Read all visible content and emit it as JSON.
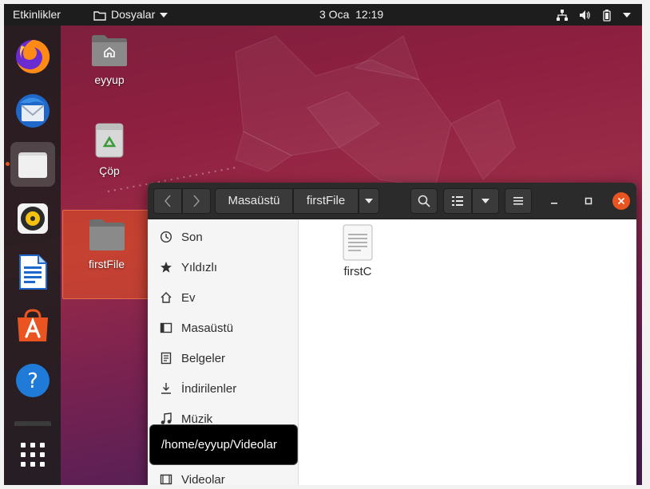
{
  "topbar": {
    "activities": "Etkinlikler",
    "app_menu": "Dosyalar",
    "clock_date": "3 Oca",
    "clock_time": "12:19"
  },
  "dock": {
    "items": [
      {
        "name": "firefox"
      },
      {
        "name": "thunderbird"
      },
      {
        "name": "files",
        "active": true
      },
      {
        "name": "rhythmbox"
      },
      {
        "name": "libreoffice-writer"
      },
      {
        "name": "ubuntu-software"
      },
      {
        "name": "help"
      },
      {
        "name": "show-applications"
      }
    ]
  },
  "desktop": {
    "home_label": "eyyup",
    "trash_label": "Çöp",
    "folder_label": "firstFile"
  },
  "window": {
    "path": [
      "Masaüstü",
      "firstFile"
    ],
    "sidebar": [
      {
        "label": "Son",
        "icon": "clock-icon"
      },
      {
        "label": "Yıldızlı",
        "icon": "star-icon"
      },
      {
        "label": "Ev",
        "icon": "home-icon"
      },
      {
        "label": "Masaüstü",
        "icon": "desktop-icon"
      },
      {
        "label": "Belgeler",
        "icon": "document-icon"
      },
      {
        "label": "İndirilenler",
        "icon": "download-icon"
      },
      {
        "label": "Müzik",
        "icon": "music-icon"
      },
      {
        "label": "Videolar",
        "icon": "video-icon"
      }
    ],
    "files": [
      {
        "name": "firstC"
      }
    ],
    "tooltip": "/home/eyyup/Videolar"
  },
  "colors": {
    "accent": "#e95420",
    "topbar": "#1d1d1d",
    "headerbar": "#2b2b2b"
  }
}
